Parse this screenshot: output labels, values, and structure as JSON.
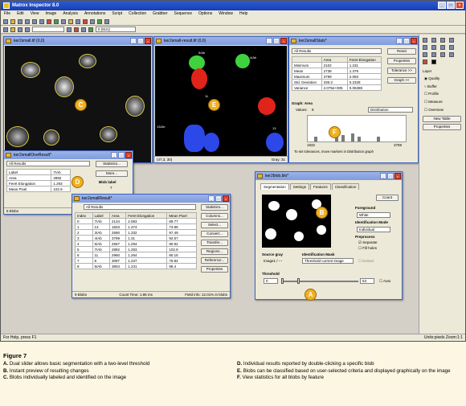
{
  "app": {
    "title": "Matrox Inspector 8.0",
    "status_left": "For Help, press F1",
    "status_right": "Units:pixels  Zoom:1:1"
  },
  "menu": [
    "File",
    "Edit",
    "View",
    "Image",
    "Analysis",
    "Annotations",
    "Script",
    "Collection",
    "Grabber",
    "Sequence",
    "Options",
    "Window",
    "Help"
  ],
  "toolbar": {
    "combo_value": "0 (8U1)"
  },
  "win_c": {
    "title": "ker2small.tif (0,0)"
  },
  "win_e": {
    "title": "ker2small-result.tif (0,0)",
    "status_coord": "(47,3, 30)",
    "status_gray": "Gray: 31"
  },
  "win_stats": {
    "title": "ker2smallStats*",
    "dropdown": "All Results",
    "col_area": "Area",
    "col_feret": "Feret Elongation",
    "rows": [
      {
        "label": "Minimum",
        "area": "2102",
        "feret": "1.231"
      },
      {
        "label": "Mean",
        "area": "2738",
        "feret": "1.379"
      },
      {
        "label": "Maximum",
        "area": "3799",
        "feret": "2.083"
      },
      {
        "label": "Std. Deviation",
        "area": "336.3",
        "feret": "0.2328"
      },
      {
        "label": "Variance",
        "area": "2.075e+005",
        "feret": "0.06388"
      }
    ],
    "btn_reset": "Reset",
    "btn_properties": "Properties",
    "btn_tolerance": "Tolerance >>",
    "btn_graph": "Graph <<",
    "graph_label": "Graph: Area",
    "values_label": "Values:",
    "values_num": "8",
    "mode": "Distribution",
    "axis_min": "1832",
    "axis_max": "3799",
    "footer": "To set tolerances, move markers in Distribution graph"
  },
  "win_one": {
    "title": "ker2smallOneResult*",
    "dropdown": "All Results",
    "rows": [
      {
        "label": "Label",
        "value": "7/Ab"
      },
      {
        "label": "Area",
        "value": "2892"
      },
      {
        "label": "Feret Elongation",
        "value": "1.293"
      },
      {
        "label": "Mean Pixel",
        "value": "102.9"
      }
    ],
    "btn_statistics": "Statistics...",
    "btn_more": "More...",
    "blob_label_title": "Blob label",
    "blob_label_value": "7",
    "status_left": "8 Blobs",
    "status_mid": "Count Time: 1.86 ms"
  },
  "win_result": {
    "title": "ker2smallResult*",
    "dropdown": "All Results",
    "headers": [
      "Index",
      "Label",
      "Area",
      "Feret Elongation",
      "Mean Pixel"
    ],
    "rows": [
      [
        "0",
        "7/Ab",
        "2134",
        "2.083",
        "89.77"
      ],
      [
        "1",
        "13",
        "1833",
        "1.374",
        "73.95"
      ],
      [
        "2",
        "3/Ab",
        "2590",
        "1.332",
        "97.49"
      ],
      [
        "3",
        "4/Ab",
        "3799",
        "1.31",
        "92.57"
      ],
      [
        "4",
        "5/Ab",
        "2557",
        "1.294",
        "90.92"
      ],
      [
        "5",
        "7/Ab",
        "2892",
        "1.293",
        "102.9"
      ],
      [
        "6",
        "11",
        "2960",
        "1.264",
        "80.15"
      ],
      [
        "7",
        "8",
        "3097",
        "1.237",
        "79.84"
      ],
      [
        "8",
        "5/Ab",
        "3904",
        "1.231",
        "98.4"
      ]
    ],
    "buttons": [
      "Statistics...",
      "Columns...",
      "Select...",
      "Convert...",
      "Transfer...",
      "Regions...",
      "Reference...",
      "Properties"
    ],
    "status_left": "9 Blobs",
    "status_mid": "Count Time: 1.86 ms",
    "status_right": "Field info: 12.01% in blobs"
  },
  "win_blob": {
    "title": "ker2blob.blo*",
    "tabs": [
      "Segmentation",
      "Settings",
      "Features",
      "Classification"
    ],
    "btn_count": "Count",
    "foreground_label": "Foreground",
    "foreground_value": "White",
    "id_mode_label": "Identification Mode",
    "id_mode_value": "Individual",
    "preprocess_label": "Preprocess",
    "separate": "Separate",
    "fill_holes": "Fill holes",
    "source_label": "Source gray",
    "source_value": "Image1 / ---",
    "mask_label": "Identification Mask",
    "mask_value": "Threshold current image",
    "extract": "Extract",
    "threshold_label": "Threshold",
    "thr_low": "0",
    "thr_high": "53",
    "auto": "Auto"
  },
  "tools": {
    "quality": "Quality",
    "buffer": "Buffer",
    "layer": "Layer",
    "profile": "Profile",
    "measure": "Measure",
    "overview": "Overview",
    "new_table": "New Table",
    "properties": "Properties"
  },
  "callouts": {
    "a": "A",
    "b": "B",
    "c": "C",
    "d": "D",
    "e": "E",
    "f": "F"
  },
  "blob_labels": [
    "5/Ab",
    "4/Ab",
    "13/Ab",
    "11",
    "13",
    "7/Ab",
    "5/Ab",
    "4/Ab"
  ],
  "caption": {
    "title": "Figure 7",
    "items": [
      {
        "letter": "A.",
        "text": "Dual slider allows basic segmentation with a two-level threshold"
      },
      {
        "letter": "B.",
        "text": "Instant preview of resulting changes"
      },
      {
        "letter": "C.",
        "text": "Blobs individually labeled and identified on the image"
      },
      {
        "letter": "D.",
        "text": "Individual results reported by double-clicking a specific blob"
      },
      {
        "letter": "E.",
        "text": "Blobs can be classified based on user-selected criteria and displayed graphically on the image"
      },
      {
        "letter": "F.",
        "text": "View statistics for all blobs by feature"
      }
    ]
  }
}
